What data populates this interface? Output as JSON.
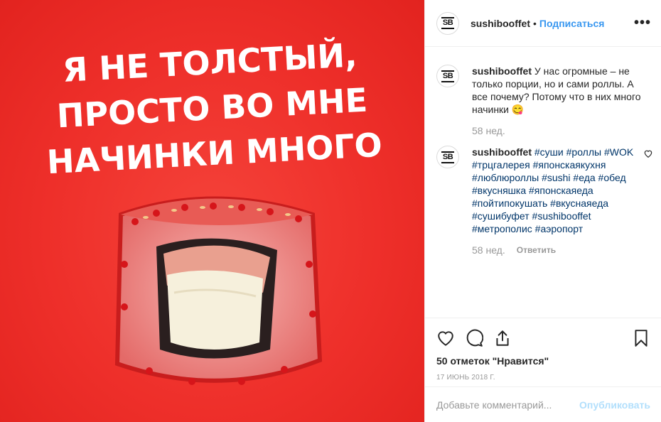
{
  "photo": {
    "slogan_lines": [
      "Я не толстый,",
      "просто во мне",
      "начинки много"
    ],
    "image": "sushi-roll-photo",
    "background_color": "#ee2f2a"
  },
  "header": {
    "username": "sushibooffet",
    "dot": "•",
    "follow_label": "Подписаться",
    "more": "•••",
    "avatar_text": "SB"
  },
  "comments": [
    {
      "username": "sushibooffet",
      "text": "У нас огромные – не только порции, но и сами роллы. А все почему? Потому что в них много начинки 😋",
      "age": "58 нед."
    },
    {
      "username": "sushibooffet",
      "text": "#суши #роллы #WOK #трцгалерея #японскаякухня #люблюроллы #sushi #еда #обед #вкусняшка #японскаяеда #пойтипокушать #вкуснаяеда #сушибуфет #sushibooffet #метрополис #аэропорт",
      "age": "58 нед.",
      "reply_label": "Ответить"
    }
  ],
  "actions": {
    "likes": "50 отметок \"Нравится\"",
    "date": "17 ИЮНЬ 2018 Г."
  },
  "add_comment": {
    "placeholder": "Добавьте комментарий...",
    "publish_label": "Опубликовать"
  },
  "colors": {
    "link": "#3897f0",
    "hashtag": "#003569",
    "muted": "#999999"
  }
}
